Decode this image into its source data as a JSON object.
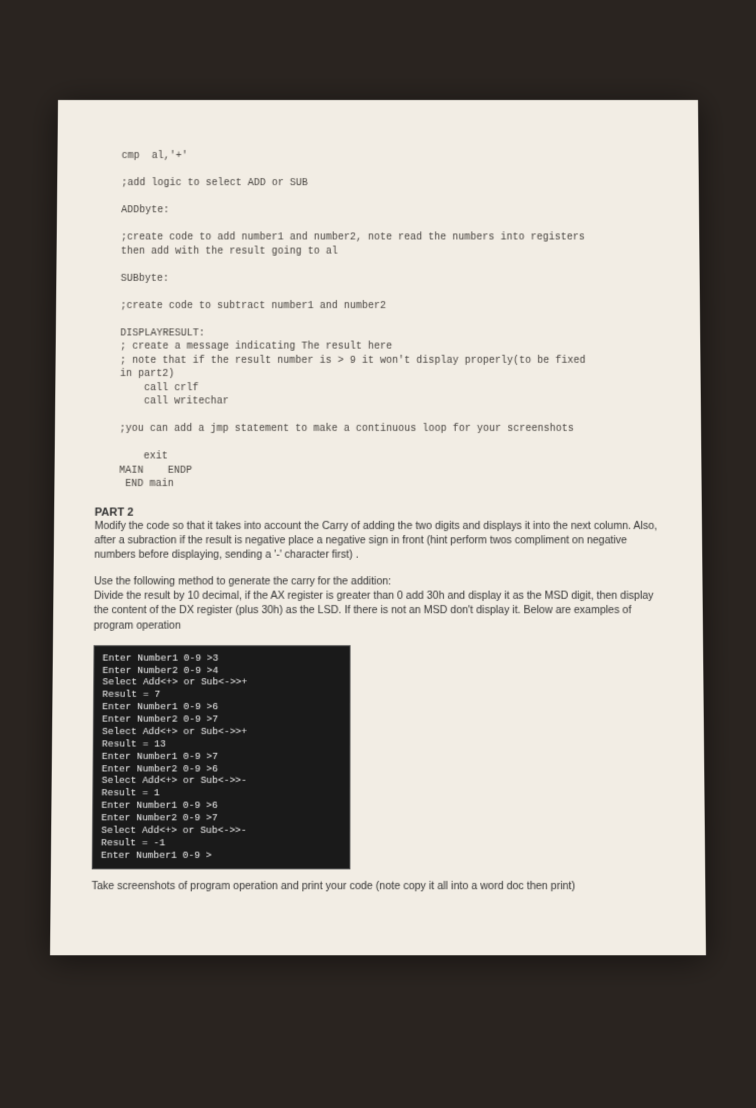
{
  "code_block": "    cmp  al,'+'\n\n    ;add logic to select ADD or SUB\n\n    ADDbyte:\n\n    ;create code to add number1 and number2, note read the numbers into registers\n    then add with the result going to al\n\n    SUBbyte:\n\n    ;create code to subtract number1 and number2\n\n    DISPLAYRESULT:\n    ; create a message indicating The result here\n    ; note that if the result number is > 9 it won't display properly(to be fixed\n    in part2)\n        call crlf\n        call writechar\n\n    ;you can add a jmp statement to make a continuous loop for your screenshots\n\n        exit\n    MAIN    ENDP\n     END main",
  "part2": {
    "title": "PART 2",
    "para1": "Modify the code so that it takes into account the Carry of adding the two digits and displays it into the next column.  Also, after a subraction if the result is negative place a negative sign in front (hint perform twos compliment on negative numbers before displaying,  sending a '-' character first) .",
    "para2": "Use the following method to generate the carry for the addition:\nDivide the result by 10 decimal, if the AX register is greater than 0 add 30h and display it as the MSD digit, then display the content of the DX register (plus 30h) as the LSD.  If there is not an MSD don't display it.  Below are examples of program operation"
  },
  "console_output": "Enter Number1 0-9 >3\nEnter Number2 0-9 >4\nSelect Add<+> or Sub<->>+\nResult = 7\nEnter Number1 0-9 >6\nEnter Number2 0-9 >7\nSelect Add<+> or Sub<->>+\nResult = 13\nEnter Number1 0-9 >7\nEnter Number2 0-9 >6\nSelect Add<+> or Sub<->>-\nResult = 1\nEnter Number1 0-9 >6\nEnter Number2 0-9 >7\nSelect Add<+> or Sub<->>-\nResult = -1\nEnter Number1 0-9 >",
  "footer": "Take screenshots of program operation and print your code (note copy it all into a word doc then print)"
}
